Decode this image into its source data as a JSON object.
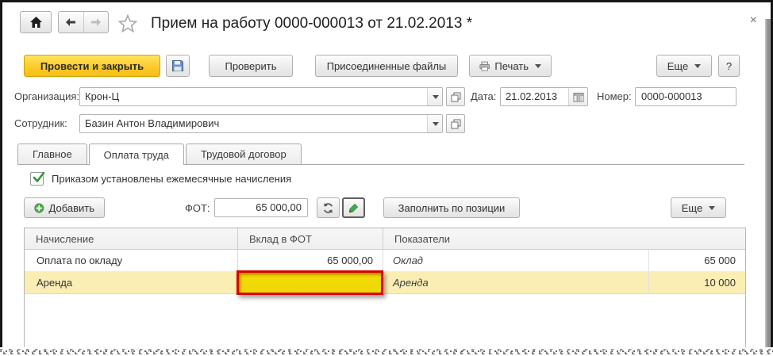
{
  "window": {
    "title": "Прием на работу 0000-000013 от 21.02.2013 *",
    "close_glyph": "×"
  },
  "toolbar": {
    "post_and_close": "Провести и закрыть",
    "verify": "Проверить",
    "attached_files": "Присоединенные файлы",
    "print": "Печать",
    "more": "Еще",
    "help": "?"
  },
  "header_fields": {
    "organization_label": "Организация:",
    "organization_value": "Крон-Ц",
    "date_label": "Дата:",
    "date_value": "21.02.2013",
    "number_label": "Номер:",
    "number_value": "0000-000013",
    "employee_label": "Сотрудник:",
    "employee_value": "Базин Антон Владимирович"
  },
  "tabs": [
    {
      "label": "Главное"
    },
    {
      "label": "Оплата труда"
    },
    {
      "label": "Трудовой договор"
    }
  ],
  "active_tab": "Оплата труда",
  "payroll_tab": {
    "monthly_accruals_checkbox": "Приказом установлены ежемесячные начисления",
    "checkbox_checked": true,
    "add_button": "Добавить",
    "fot_label": "ФОТ:",
    "fot_value": "65 000,00",
    "fill_by_position_button": "Заполнить по позиции",
    "more_button": "Еще"
  },
  "accruals_table": {
    "columns": [
      "Начисление",
      "Вклад в ФОТ",
      "Показатели"
    ],
    "rows": [
      {
        "accrual": "Оплата по окладу",
        "fot_contribution": "65 000,00",
        "indicator": "Оклад",
        "indicator_value": "65 000",
        "selected": false
      },
      {
        "accrual": "Аренда",
        "fot_contribution": "",
        "indicator": "Аренда",
        "indicator_value": "10 000",
        "selected": true
      }
    ]
  },
  "icons": {
    "home": "house",
    "back": "arrow-left",
    "forward": "arrow-right",
    "favorite": "star-outline",
    "save": "floppy-disk",
    "print": "printer",
    "calendar": "calendar-grid",
    "picker": "overlapping-windows",
    "dropdown": "caret-down",
    "refresh": "circular-arrows",
    "edit": "green-pencil",
    "add": "green-plus-circle",
    "checkbox_check": "green-check"
  },
  "colors": {
    "primary_button": "#fbc829",
    "selected_row": "#fbeeb5",
    "selected_cell_fill": "#efd704",
    "selected_cell_border": "#dd0101",
    "header_bg": "#f4f4f4",
    "window_border": "#161616"
  }
}
